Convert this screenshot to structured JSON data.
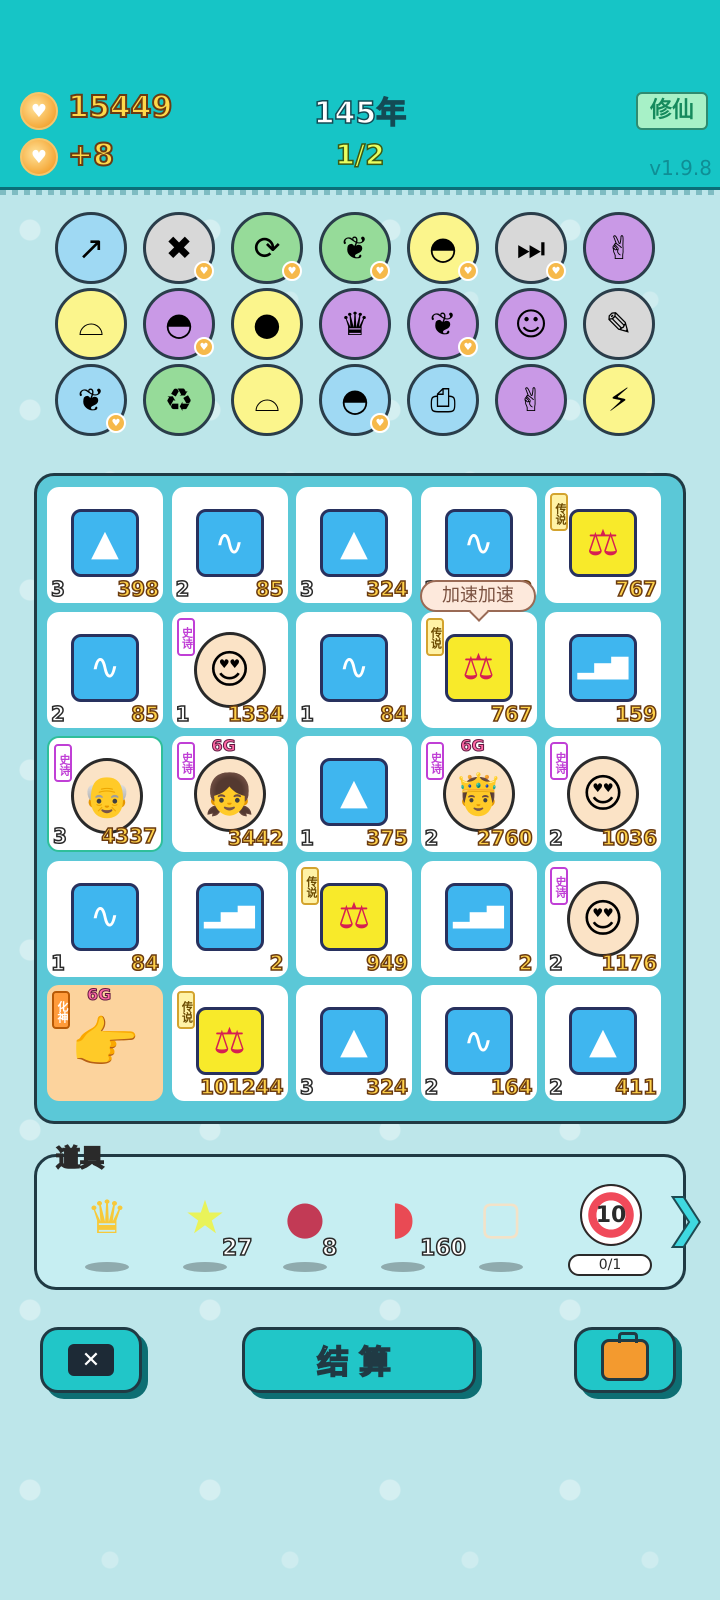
{
  "header": {
    "gold": "15449",
    "income": "+8",
    "year": "145年",
    "progress": "1/2",
    "cultivate_label": "修仙",
    "version": "v1.9.8"
  },
  "skills": [
    {
      "icon": "growth-arrow-icon",
      "color": "#9fd9f3"
    },
    {
      "icon": "close-tag-icon",
      "color": "#d8d8d8"
    },
    {
      "icon": "refresh-icon",
      "color": "#96db99"
    },
    {
      "icon": "leaf-icon",
      "color": "#96db99"
    },
    {
      "icon": "rice-bowl-icon",
      "color": "#fbf58c"
    },
    {
      "icon": "skip-icon",
      "color": "#d8d8d8"
    },
    {
      "icon": "rock-hand-icon",
      "color": "#c999e6"
    },
    {
      "icon": "shell-icon",
      "color": "#fbf58c"
    },
    {
      "icon": "rice-bowl-icon",
      "color": "#c999e6"
    },
    {
      "icon": "basketballs-icon",
      "color": "#fbf58c"
    },
    {
      "icon": "crown-card-icon",
      "color": "#c999e6"
    },
    {
      "icon": "leaf-icon",
      "color": "#c999e6"
    },
    {
      "icon": "time-magazine-icon",
      "color": "#c999e6"
    },
    {
      "icon": "screwdriver-icon",
      "color": "#d8d8d8"
    },
    {
      "icon": "leaf-icon",
      "color": "#9fd9f3"
    },
    {
      "icon": "recycle-icon",
      "color": "#96db99"
    },
    {
      "icon": "shell-icon",
      "color": "#fbf58c"
    },
    {
      "icon": "rice-bowl-icon",
      "color": "#9fd9f3"
    },
    {
      "icon": "printer-icon",
      "color": "#9fd9f3"
    },
    {
      "icon": "rock-hand-icon",
      "color": "#c999e6"
    },
    {
      "icon": "lightning-icon",
      "color": "#fbf58c"
    }
  ],
  "board": {
    "speech": "加速加速",
    "tiles": [
      {
        "type": "gold-bars",
        "level": "3",
        "value": "398"
      },
      {
        "type": "trend-line",
        "level": "2",
        "value": "85"
      },
      {
        "type": "gold-bars",
        "level": "3",
        "value": "324"
      },
      {
        "type": "trend-line",
        "level": "2",
        "value": "102"
      },
      {
        "type": "scale",
        "tag": "传说",
        "level": "",
        "value": "767"
      },
      {
        "type": "trend-line",
        "level": "2",
        "value": "85"
      },
      {
        "type": "old-man-hearts",
        "tag": "史诗",
        "level": "1",
        "value": "1334"
      },
      {
        "type": "trend-line",
        "level": "1",
        "value": "84"
      },
      {
        "type": "scale",
        "tag": "传说",
        "level": "",
        "value": "767"
      },
      {
        "type": "bar-chart",
        "level": "",
        "value": "159"
      },
      {
        "type": "old-man-glasses",
        "tag": "史诗",
        "level": "3",
        "value": "4337"
      },
      {
        "type": "girl",
        "tag": "史诗",
        "badge": "6G",
        "level": "",
        "value": "3442"
      },
      {
        "type": "gold-bars",
        "level": "1",
        "value": "375"
      },
      {
        "type": "old-man-crown",
        "tag": "史诗",
        "badge": "6G",
        "level": "2",
        "value": "2760"
      },
      {
        "type": "old-man-hearts",
        "tag": "史诗",
        "level": "2",
        "value": "1036"
      },
      {
        "type": "trend-line",
        "level": "1",
        "value": "84"
      },
      {
        "type": "bar-chart",
        "level": "",
        "value": "2"
      },
      {
        "type": "scale",
        "tag": "传说",
        "level": "",
        "value": "949"
      },
      {
        "type": "bar-chart",
        "level": "",
        "value": "2"
      },
      {
        "type": "old-man-hearts",
        "tag": "史诗",
        "level": "2",
        "value": "1176"
      },
      {
        "type": "pointing-hand",
        "tag": "化神",
        "badge": "6G",
        "level": "",
        "value": ""
      },
      {
        "type": "scale",
        "tag": "传说",
        "level": "",
        "value": "101244"
      },
      {
        "type": "gold-bars",
        "level": "3",
        "value": "324"
      },
      {
        "type": "trend-line",
        "level": "2",
        "value": "164"
      },
      {
        "type": "gold-bars",
        "level": "2",
        "value": "411"
      }
    ]
  },
  "props": {
    "title": "道具",
    "items": [
      {
        "icon": "crown-icon",
        "count": ""
      },
      {
        "icon": "star-icon",
        "count": "27"
      },
      {
        "icon": "lychee-icon",
        "count": "8"
      },
      {
        "icon": "liver-icon",
        "count": "160"
      },
      {
        "icon": "frame-icon",
        "count": ""
      }
    ],
    "target_value": "10",
    "target_progress": "0/1"
  },
  "buttons": {
    "settle": "结算"
  }
}
